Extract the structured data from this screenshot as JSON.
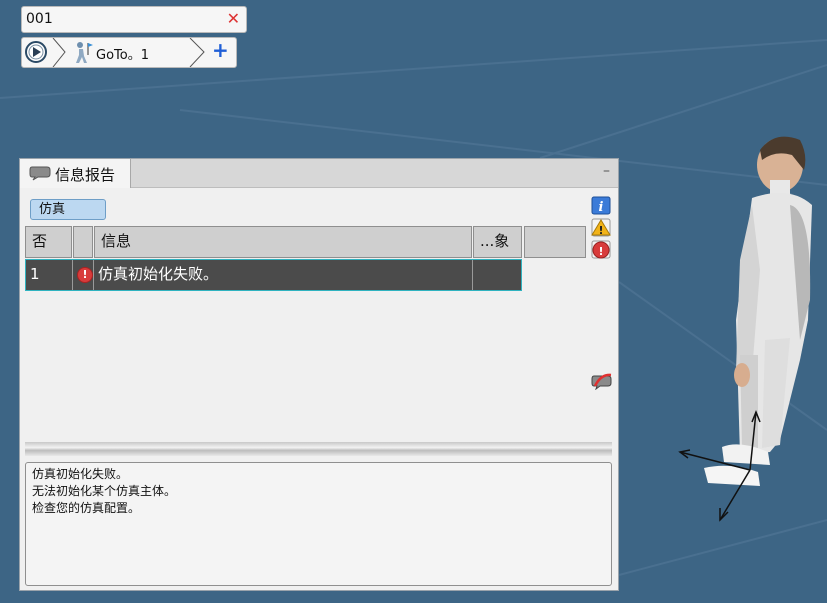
{
  "toolbar": {
    "name_field": {
      "value": "001"
    },
    "sequence": {
      "step_label": "GoTo。1"
    }
  },
  "report_panel": {
    "tab_title": "信息报告",
    "filter_button": "仿真",
    "columns": [
      "否",
      "",
      "信息",
      "...象",
      ""
    ],
    "messages": [
      {
        "number": "1",
        "severity": "error",
        "text": "仿真初始化失败。",
        "object": ""
      }
    ],
    "details": [
      "仿真初始化失败。",
      "无法初始化某个仿真主体。",
      "检查您的仿真配置。"
    ]
  },
  "colors": {
    "background": "#3d6585",
    "selected_row": "#4b4b4b",
    "selection_border": "#2fb3c0",
    "error": "#d83b3b",
    "filter_button": "#bcd8f1"
  }
}
